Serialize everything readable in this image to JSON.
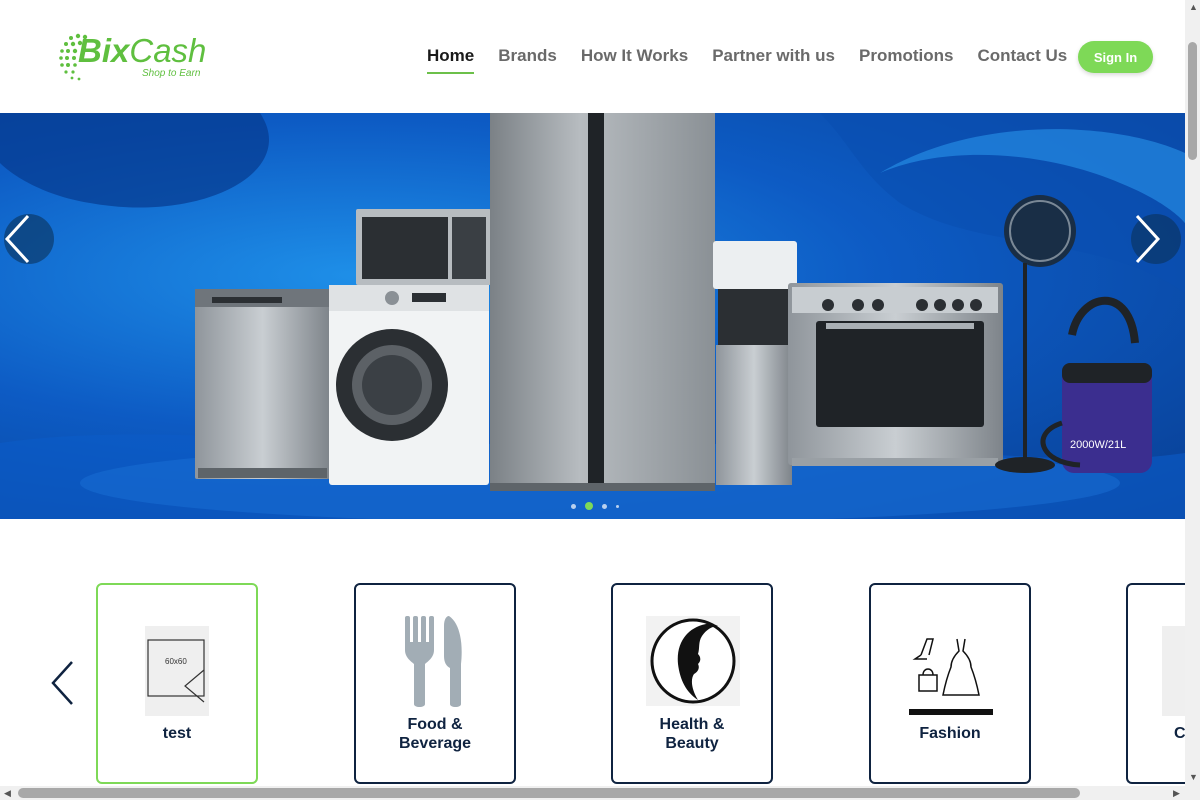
{
  "logo": {
    "brand_bold": "Bix",
    "brand_light": "Cash",
    "tagline": "Shop to Earn"
  },
  "nav": {
    "items": [
      {
        "label": "Home",
        "active": true
      },
      {
        "label": "Brands"
      },
      {
        "label": "How It Works"
      },
      {
        "label": "Partner with us"
      },
      {
        "label": "Promotions"
      },
      {
        "label": "Contact Us"
      }
    ],
    "signin_label": "Sign In"
  },
  "hero": {
    "slide_count": 4,
    "active_slide": 2,
    "appliance_labels": {
      "vacuum": "2000W/21L"
    }
  },
  "categories": [
    {
      "label": "test",
      "icon": "placeholder-image-icon",
      "placeholder_text": "60x60",
      "active": true
    },
    {
      "label": "Food & Beverage",
      "label_lines": [
        "Food &",
        "Beverage"
      ],
      "icon": "fork-knife-icon"
    },
    {
      "label": "Health & Beauty",
      "label_lines": [
        "Health &",
        "Beauty"
      ],
      "icon": "face-silhouette-icon"
    },
    {
      "label": "Fashion",
      "icon": "fashion-icon"
    },
    {
      "label": "C",
      "icon": "partial-icon"
    }
  ],
  "colors": {
    "accent_green": "#7ed957",
    "navy": "#0f2340",
    "hero_blue": "#0d5bc4"
  }
}
